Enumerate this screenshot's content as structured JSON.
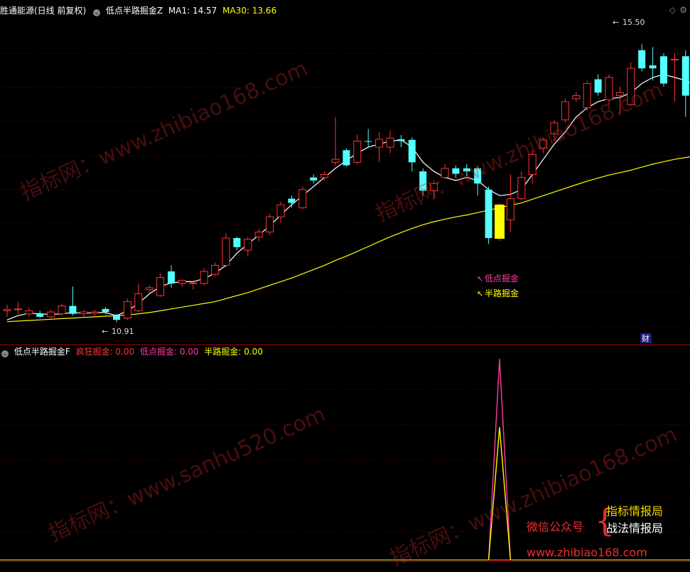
{
  "main_header": {
    "symbol": "胜通能源(日线 前复权)",
    "indicator": "低点半路掘金Z",
    "ma1_label": "MA1: 14.57",
    "ma30_label": "MA30: 13.66"
  },
  "sub_header": {
    "indicator": "低点半路掘金F",
    "crazy": "疯狂掘金: 0.00",
    "low": "低点掘金: 0.00",
    "half": "半路掘金: 0.00"
  },
  "annotations": {
    "high_label": "15.50",
    "low_label": "10.91",
    "signal_low": "低点掘金",
    "signal_half": "半路掘金",
    "fin_badge": "财"
  },
  "watermarks": [
    "指标网：www.zhibiao168.com",
    "指标网：www.sanhu520.com",
    "指标网：www.zhibiao168.com"
  ],
  "promo": {
    "left": "微信公众号",
    "right1": "指标情报局",
    "right2": "战法情报局",
    "url": "www.zhibiao168.com"
  },
  "colors": {
    "up": "#ff3232",
    "down": "#54ffff",
    "ma1": "#ffffff",
    "ma30": "#ffff00",
    "signal_bar": "#ffff00",
    "osc_outer": "#ff3ca0",
    "osc_inner": "#ffff00"
  },
  "chart_data": [
    {
      "type": "candlestick",
      "ylim": [
        10.6,
        15.9
      ],
      "series_names": [
        "MA1",
        "MA30"
      ],
      "candles": [
        [
          11.1,
          11.12,
          11.2,
          11.0
        ],
        [
          11.12,
          11.13,
          11.25,
          11.05
        ],
        [
          11.05,
          11.1,
          11.15,
          11.0
        ],
        [
          11.05,
          11.0,
          11.1,
          10.98
        ],
        [
          11.0,
          11.08,
          11.12,
          10.98
        ],
        [
          11.05,
          11.18,
          11.22,
          11.02
        ],
        [
          11.18,
          11.05,
          11.5,
          11.02
        ],
        [
          11.05,
          11.08,
          11.12,
          11.0
        ],
        [
          11.06,
          11.08,
          11.12,
          11.0
        ],
        [
          11.13,
          11.08,
          11.16,
          11.04
        ],
        [
          11.02,
          10.95,
          11.05,
          10.91
        ],
        [
          10.98,
          11.25,
          11.3,
          10.95
        ],
        [
          11.1,
          11.38,
          11.55,
          11.08
        ],
        [
          11.45,
          11.48,
          11.52,
          11.38
        ],
        [
          11.35,
          11.65,
          11.72,
          11.33
        ],
        [
          11.75,
          11.55,
          11.85,
          11.48
        ],
        [
          11.55,
          11.6,
          11.62,
          11.5
        ],
        [
          11.55,
          11.56,
          11.6,
          11.45
        ],
        [
          11.55,
          11.75,
          11.8,
          11.52
        ],
        [
          11.7,
          11.85,
          11.9,
          11.68
        ],
        [
          11.85,
          12.3,
          12.38,
          11.82
        ],
        [
          12.3,
          12.15,
          12.32,
          12.1
        ],
        [
          12.1,
          12.28,
          12.32,
          12.0
        ],
        [
          12.32,
          12.4,
          12.45,
          12.25
        ],
        [
          12.4,
          12.65,
          12.7,
          12.35
        ],
        [
          12.65,
          12.85,
          12.9,
          12.55
        ],
        [
          12.95,
          12.88,
          13.0,
          12.8
        ],
        [
          12.8,
          13.1,
          13.15,
          12.78
        ],
        [
          13.3,
          13.25,
          13.35,
          13.2
        ],
        [
          13.3,
          13.35,
          13.4,
          13.25
        ],
        [
          13.55,
          13.6,
          14.3,
          13.5
        ],
        [
          13.75,
          13.5,
          13.78,
          13.48
        ],
        [
          13.55,
          13.9,
          14.0,
          13.52
        ],
        [
          13.9,
          13.89,
          14.1,
          13.8
        ],
        [
          13.8,
          13.93,
          14.05,
          13.55
        ],
        [
          13.8,
          13.95,
          14.08,
          13.7
        ],
        [
          13.93,
          13.9,
          14.0,
          13.8
        ],
        [
          13.92,
          13.55,
          13.96,
          13.4
        ],
        [
          13.4,
          13.08,
          13.45,
          13.0
        ],
        [
          13.08,
          13.2,
          13.25,
          12.95
        ],
        [
          13.3,
          13.45,
          13.52,
          13.27
        ],
        [
          13.45,
          13.36,
          13.5,
          13.3
        ],
        [
          13.45,
          13.4,
          13.52,
          13.32
        ],
        [
          13.45,
          13.2,
          13.48,
          13.0
        ],
        [
          13.1,
          12.3,
          13.15,
          12.2
        ],
        [
          12.3,
          12.85,
          12.88,
          12.25
        ],
        [
          12.6,
          12.95,
          13.35,
          12.4
        ],
        [
          12.95,
          13.3,
          13.4,
          12.92
        ],
        [
          13.35,
          13.68,
          13.75,
          13.2
        ],
        [
          13.78,
          13.92,
          13.95,
          13.7
        ],
        [
          14.02,
          14.2,
          14.25,
          13.9
        ],
        [
          14.25,
          14.55,
          14.6,
          14.2
        ],
        [
          14.6,
          14.65,
          14.7,
          14.55
        ],
        [
          14.45,
          14.85,
          14.9,
          14.4
        ],
        [
          14.92,
          14.7,
          15.0,
          14.65
        ],
        [
          14.58,
          14.95,
          15.0,
          14.5
        ],
        [
          14.65,
          14.7,
          14.8,
          14.35
        ],
        [
          14.5,
          15.1,
          15.2,
          14.48
        ],
        [
          15.4,
          15.1,
          15.5,
          15.05
        ],
        [
          15.15,
          15.1,
          15.45,
          14.9
        ],
        [
          15.3,
          14.85,
          15.35,
          14.8
        ],
        [
          15.25,
          15.25,
          15.35,
          14.55
        ],
        [
          15.3,
          14.65,
          15.4,
          14.3
        ],
        [
          14.6,
          14.6,
          14.65,
          14.45
        ],
        [
          14.6,
          14.18,
          14.68,
          14.15
        ]
      ],
      "ma1": [
        10.95,
        11.02,
        11.06,
        11.05,
        11.04,
        11.05,
        11.07,
        11.06,
        11.07,
        11.07,
        11.02,
        11.1,
        11.22,
        11.38,
        11.5,
        11.56,
        11.58,
        11.58,
        11.63,
        11.72,
        11.85,
        12.05,
        12.2,
        12.35,
        12.5,
        12.68,
        12.85,
        13.0,
        13.15,
        13.3,
        13.45,
        13.58,
        13.7,
        13.8,
        13.85,
        13.9,
        13.92,
        13.8,
        13.55,
        13.4,
        13.3,
        13.25,
        13.3,
        13.25,
        13.1,
        13.0,
        13.02,
        13.1,
        13.35,
        13.6,
        13.85,
        14.05,
        14.3,
        14.45,
        14.55,
        14.6,
        14.62,
        14.7,
        14.85,
        14.95,
        15.0,
        14.95,
        14.9,
        14.8,
        14.7
      ],
      "ma30": [
        10.92,
        10.93,
        10.94,
        10.95,
        10.96,
        10.97,
        10.98,
        10.99,
        11.0,
        11.01,
        11.02,
        11.03,
        11.05,
        11.07,
        11.1,
        11.13,
        11.16,
        11.19,
        11.22,
        11.25,
        11.3,
        11.35,
        11.4,
        11.46,
        11.52,
        11.58,
        11.64,
        11.71,
        11.78,
        11.85,
        11.93,
        12.0,
        12.08,
        12.16,
        12.24,
        12.32,
        12.39,
        12.46,
        12.52,
        12.57,
        12.61,
        12.65,
        12.68,
        12.72,
        12.76,
        12.8,
        12.84,
        12.88,
        12.94,
        13.0,
        13.06,
        13.12,
        13.18,
        13.24,
        13.29,
        13.34,
        13.38,
        13.42,
        13.47,
        13.52,
        13.56,
        13.6,
        13.63,
        13.65,
        13.67
      ]
    },
    {
      "type": "line",
      "ylim": [
        0,
        100
      ],
      "series_names": [
        "疯狂掘金",
        "低点掘金",
        "半路掘金"
      ],
      "series": [
        {
          "name": "疯狂掘金",
          "values_by_index": {
            "43": 0,
            "44": 0,
            "45": 0
          }
        },
        {
          "name": "低点掘金",
          "values_by_index": {
            "43": 0,
            "44": 100,
            "45": 0
          }
        },
        {
          "name": "半路掘金",
          "values_by_index": {
            "43": 0,
            "44": 66,
            "45": 0
          }
        }
      ]
    }
  ]
}
